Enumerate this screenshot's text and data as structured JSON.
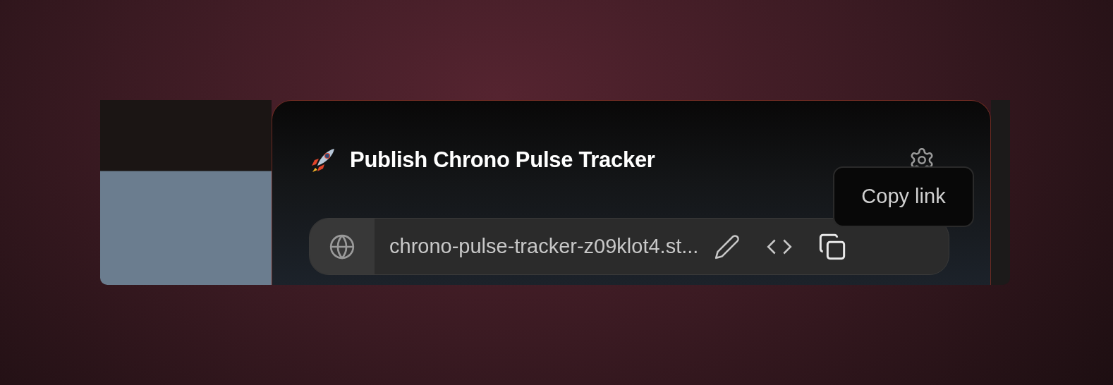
{
  "dialog": {
    "title": "Publish Chrono Pulse Tracker"
  },
  "url_bar": {
    "url": "chrono-pulse-tracker-z09klot4.st..."
  },
  "tooltip": {
    "text": "Copy link"
  }
}
